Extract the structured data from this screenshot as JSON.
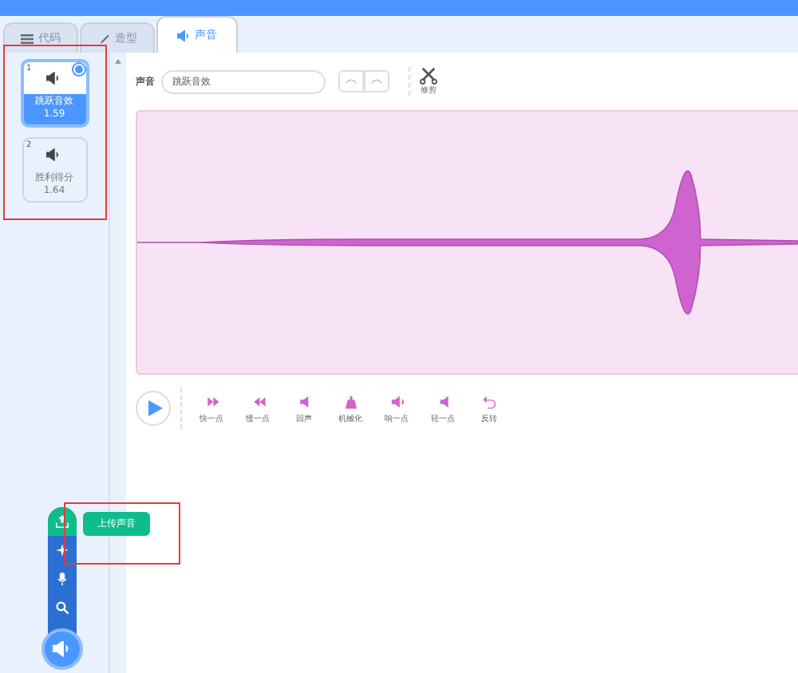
{
  "tabs": [
    {
      "label": "代码",
      "kind": "code",
      "selected": false
    },
    {
      "label": "造型",
      "kind": "costume",
      "selected": false
    },
    {
      "label": "声音",
      "kind": "sound",
      "selected": true
    }
  ],
  "sounds": [
    {
      "number": "1",
      "name": "跳跃音效",
      "duration": "1.59",
      "selected": true
    },
    {
      "number": "2",
      "name": "胜利得分",
      "duration": "1.64",
      "selected": false
    }
  ],
  "editor": {
    "label": "声音",
    "value": "跳跃音效",
    "trim": "修剪"
  },
  "effects": [
    {
      "label": "快一点",
      "kind": "faster"
    },
    {
      "label": "慢一点",
      "kind": "slower"
    },
    {
      "label": "回声",
      "kind": "echo"
    },
    {
      "label": "机械化",
      "kind": "robot"
    },
    {
      "label": "响一点",
      "kind": "louder"
    },
    {
      "label": "轻一点",
      "kind": "softer"
    },
    {
      "label": "反转",
      "kind": "reverse"
    }
  ],
  "tooltip": "上传声音"
}
